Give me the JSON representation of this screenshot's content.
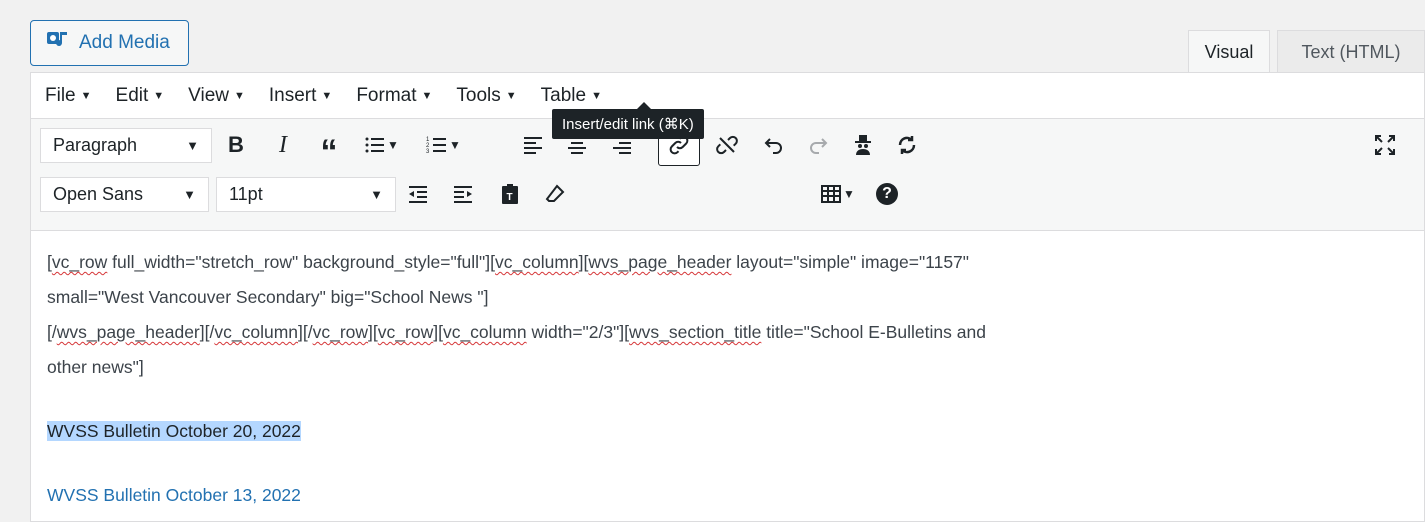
{
  "add_media": {
    "label": "Add Media",
    "icon": "media-upload-icon"
  },
  "mode_tabs": {
    "visual": "Visual",
    "text": "Text (HTML)"
  },
  "menubar": {
    "items": [
      "File",
      "Edit",
      "View",
      "Insert",
      "Format",
      "Tools",
      "Table"
    ]
  },
  "toolbar": {
    "paragraph_select": "Paragraph",
    "font_select": "Open Sans",
    "size_select": "11pt",
    "tooltip": "Insert/edit link (⌘K)",
    "icons_row1": [
      "bold-icon",
      "italic-icon",
      "blockquote-icon",
      "bullet-list-icon",
      "numbered-list-icon",
      "align-left-icon",
      "align-center-icon",
      "align-right-icon",
      "link-icon",
      "unlink-icon",
      "undo-icon",
      "redo-icon",
      "spy-icon",
      "refresh-icon",
      "fullscreen-icon"
    ],
    "icons_row2": [
      "outdent-icon",
      "indent-icon",
      "paste-as-text-icon",
      "clear-formatting-icon",
      "table-icon",
      "help-icon"
    ],
    "glyphs": {
      "bold": "B",
      "italic": "I",
      "blockquote": "“",
      "help": "?"
    }
  },
  "content": {
    "line1_parts": [
      "[",
      "vc_row",
      " full_width=\"stretch_row\" background_style=\"full\"][",
      "vc_column",
      "][",
      "wvs_page_header",
      " layout=\"simple\" image=\"1157\""
    ],
    "line2": "small=\"West Vancouver Secondary\" big=\"School News \"]",
    "line3_parts": [
      "[/",
      "wvs_page_header",
      "][/",
      "vc_column",
      "][/",
      "vc_row",
      "][",
      "vc_row",
      "][",
      "vc_column",
      " width=\"2/3\"][",
      "wvs_section_title",
      " title=\"School E-Bulletins and"
    ],
    "line4": "other news\"]",
    "selected_line": "WVSS Bulletin October 20, 2022",
    "link_line": "WVSS Bulletin October 13, 2022"
  },
  "colors": {
    "accent": "#2271b1",
    "selection": "#b4d7ff",
    "spellcheck": "#d63638"
  }
}
